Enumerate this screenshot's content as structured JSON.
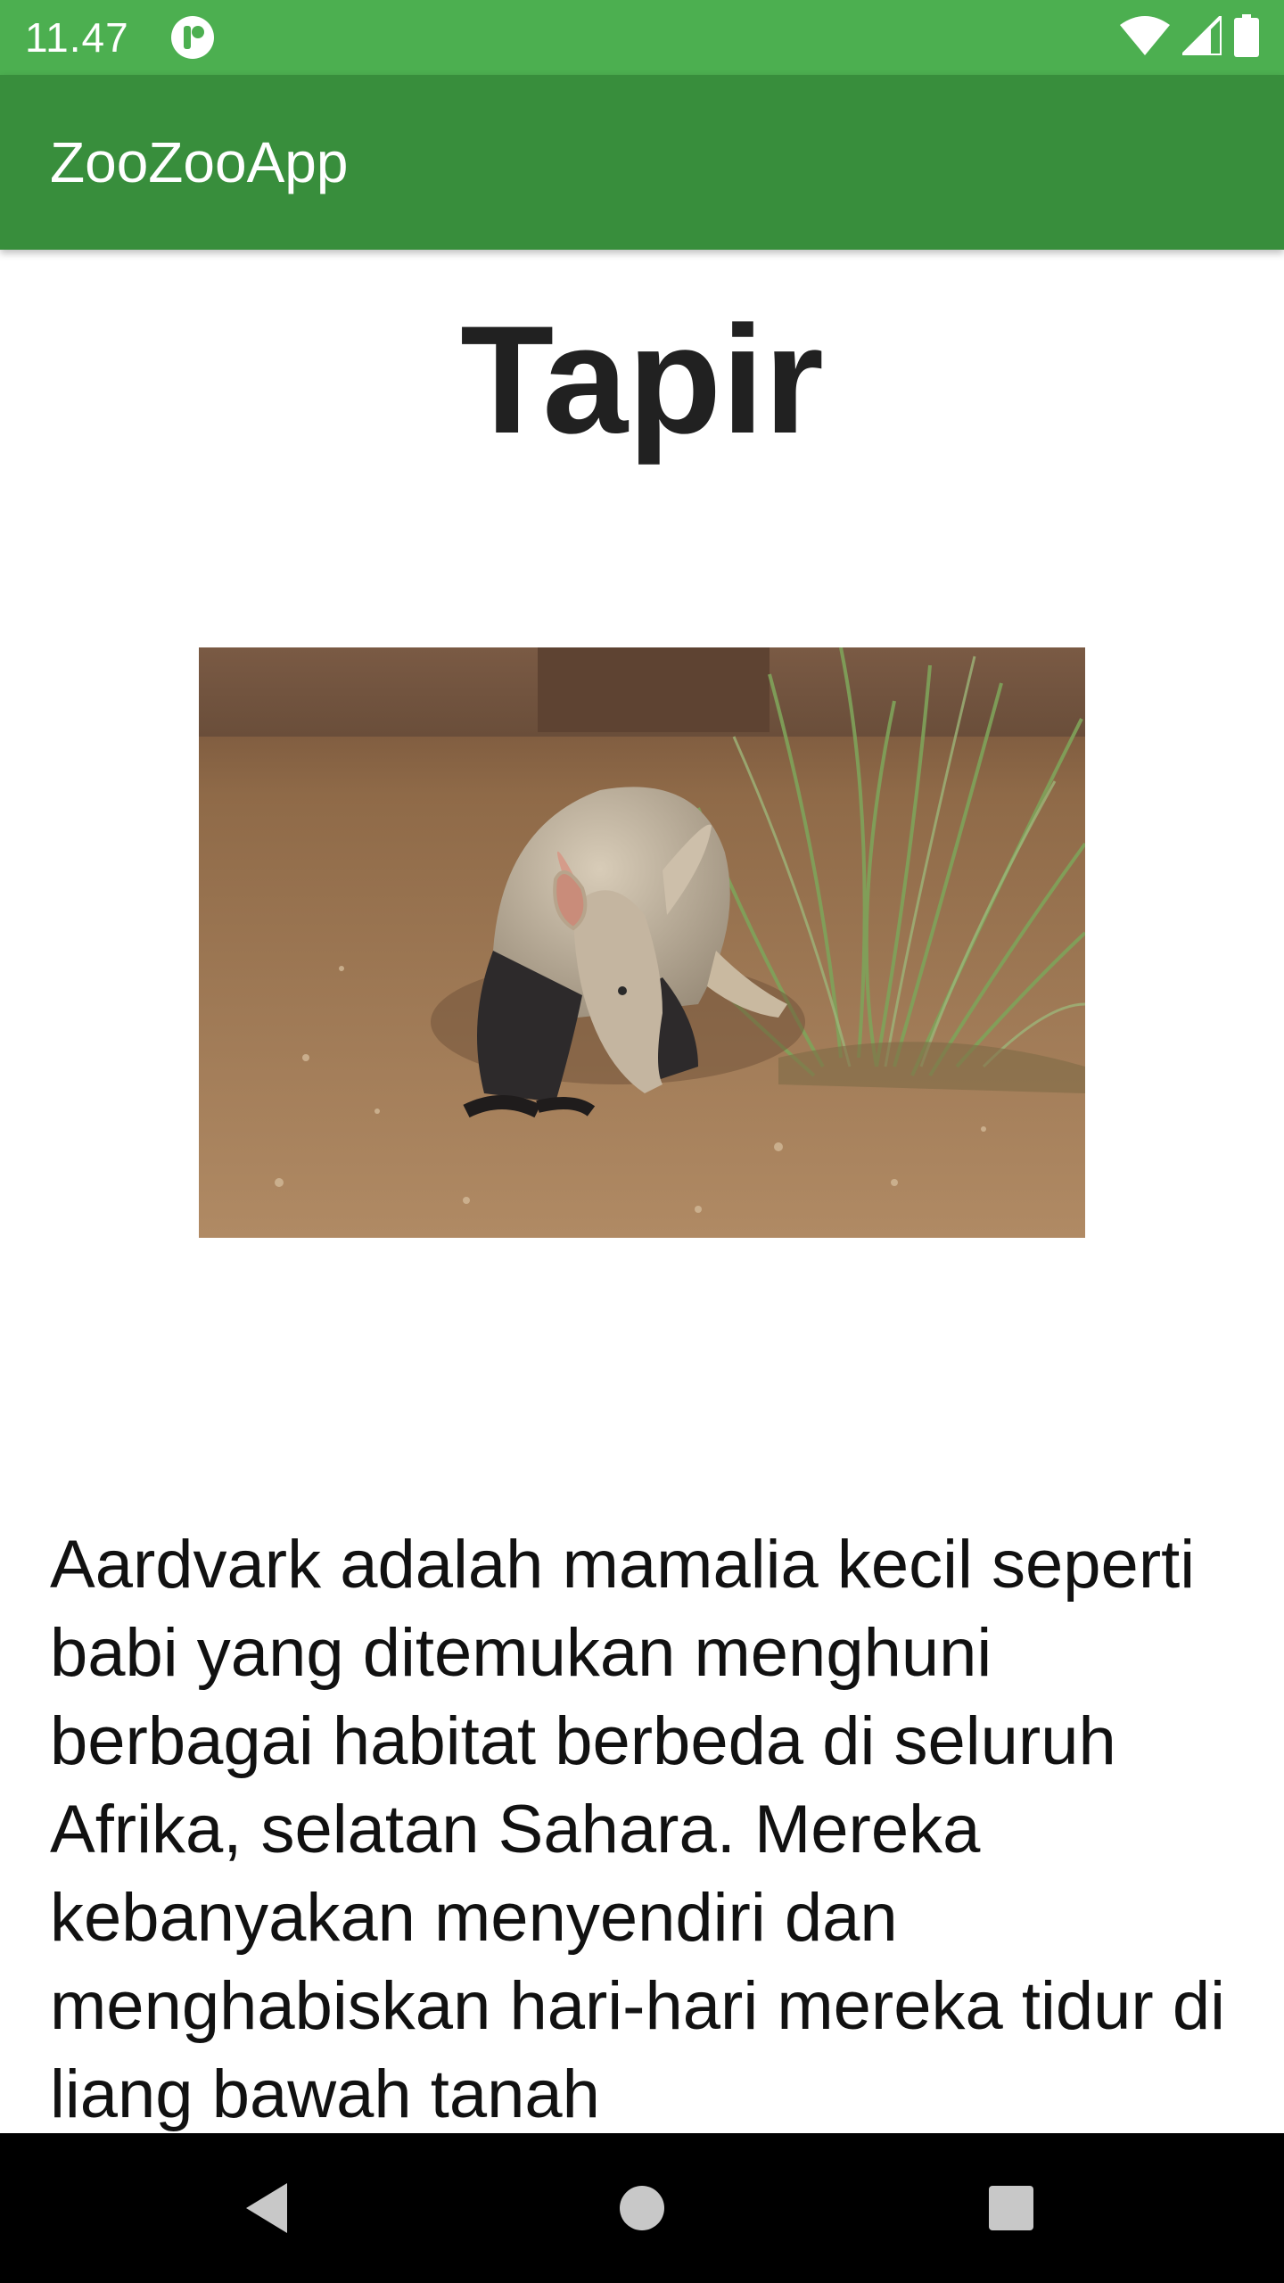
{
  "status_bar": {
    "time": "11.47",
    "icons": [
      "app-notification-icon",
      "wifi-icon",
      "signal-icon",
      "battery-icon"
    ]
  },
  "app_bar": {
    "title": "ZooZooApp"
  },
  "animal": {
    "name": "Tapir",
    "image_alt": "aardvark-photo",
    "description": "Aardvark adalah mamalia kecil seperti babi yang ditemukan menghuni berbagai habitat berbeda di seluruh Afrika, selatan Sahara. Mereka kebanyakan menyendiri dan menghabiskan hari-hari mereka tidur di liang bawah tanah"
  },
  "nav_bar": {
    "icons": [
      "back-icon",
      "home-icon",
      "recents-icon"
    ]
  },
  "colors": {
    "status_bar": "#4caf50",
    "app_bar": "#388e3c",
    "nav_bar": "#000000"
  }
}
